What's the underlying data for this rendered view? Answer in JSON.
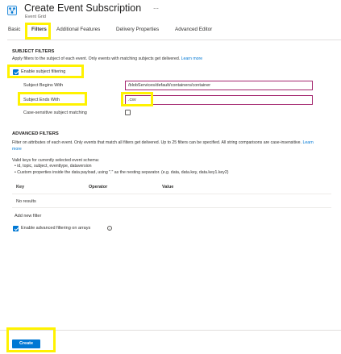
{
  "header": {
    "title": "Create Event Subscription",
    "subtitle": "Event Grid",
    "pin_glyph": "⋯"
  },
  "tabs": [
    {
      "label": "Basic"
    },
    {
      "label": "Filters"
    },
    {
      "label": "Additional Features"
    },
    {
      "label": "Delivery Properties"
    },
    {
      "label": "Advanced Editor"
    }
  ],
  "subject_filters": {
    "section_title": "SUBJECT FILTERS",
    "description": "Apply filters to the subject of each event. Only events with matching subjects get delivered.",
    "learn_more": "Learn more",
    "enable_label": "Enable subject filtering",
    "enable_checked": true,
    "begins_with_label": "Subject Begins With",
    "begins_with_value": "/blobServices/default/containers/container",
    "ends_with_label": "Subject Ends With",
    "ends_with_value": ".csv",
    "case_sensitive_label": "Case-sensitive subject matching",
    "case_sensitive_checked": false
  },
  "advanced_filters": {
    "section_title": "ADVANCED FILTERS",
    "description": "Filter on attributes of each event. Only events that match all filters get delivered. Up to 25 filters can be specified. All string comparisons are case-insensitive.",
    "learn_more": "Learn more",
    "valid_keys_intro": "Valid keys for currently selected event schema:",
    "valid_keys": [
      "id, topic, subject, eventtype, dataversion",
      "Custom properties inside the data payload, using \".\" as the nesting separator. (e.g. data, data.key, data.key1.key2)"
    ],
    "columns": {
      "key": "Key",
      "operator": "Operator",
      "value": "Value"
    },
    "empty_text": "No results",
    "add_filter": "Add new filter",
    "arrays_label": "Enable advanced filtering on arrays",
    "arrays_checked": true
  },
  "footer": {
    "create_label": "Create"
  },
  "colors": {
    "accent": "#0078d4",
    "highlight": "#fff200",
    "field_border": "#a4266f"
  },
  "icons": {
    "app": "event-grid-icon",
    "info": "info-icon"
  }
}
